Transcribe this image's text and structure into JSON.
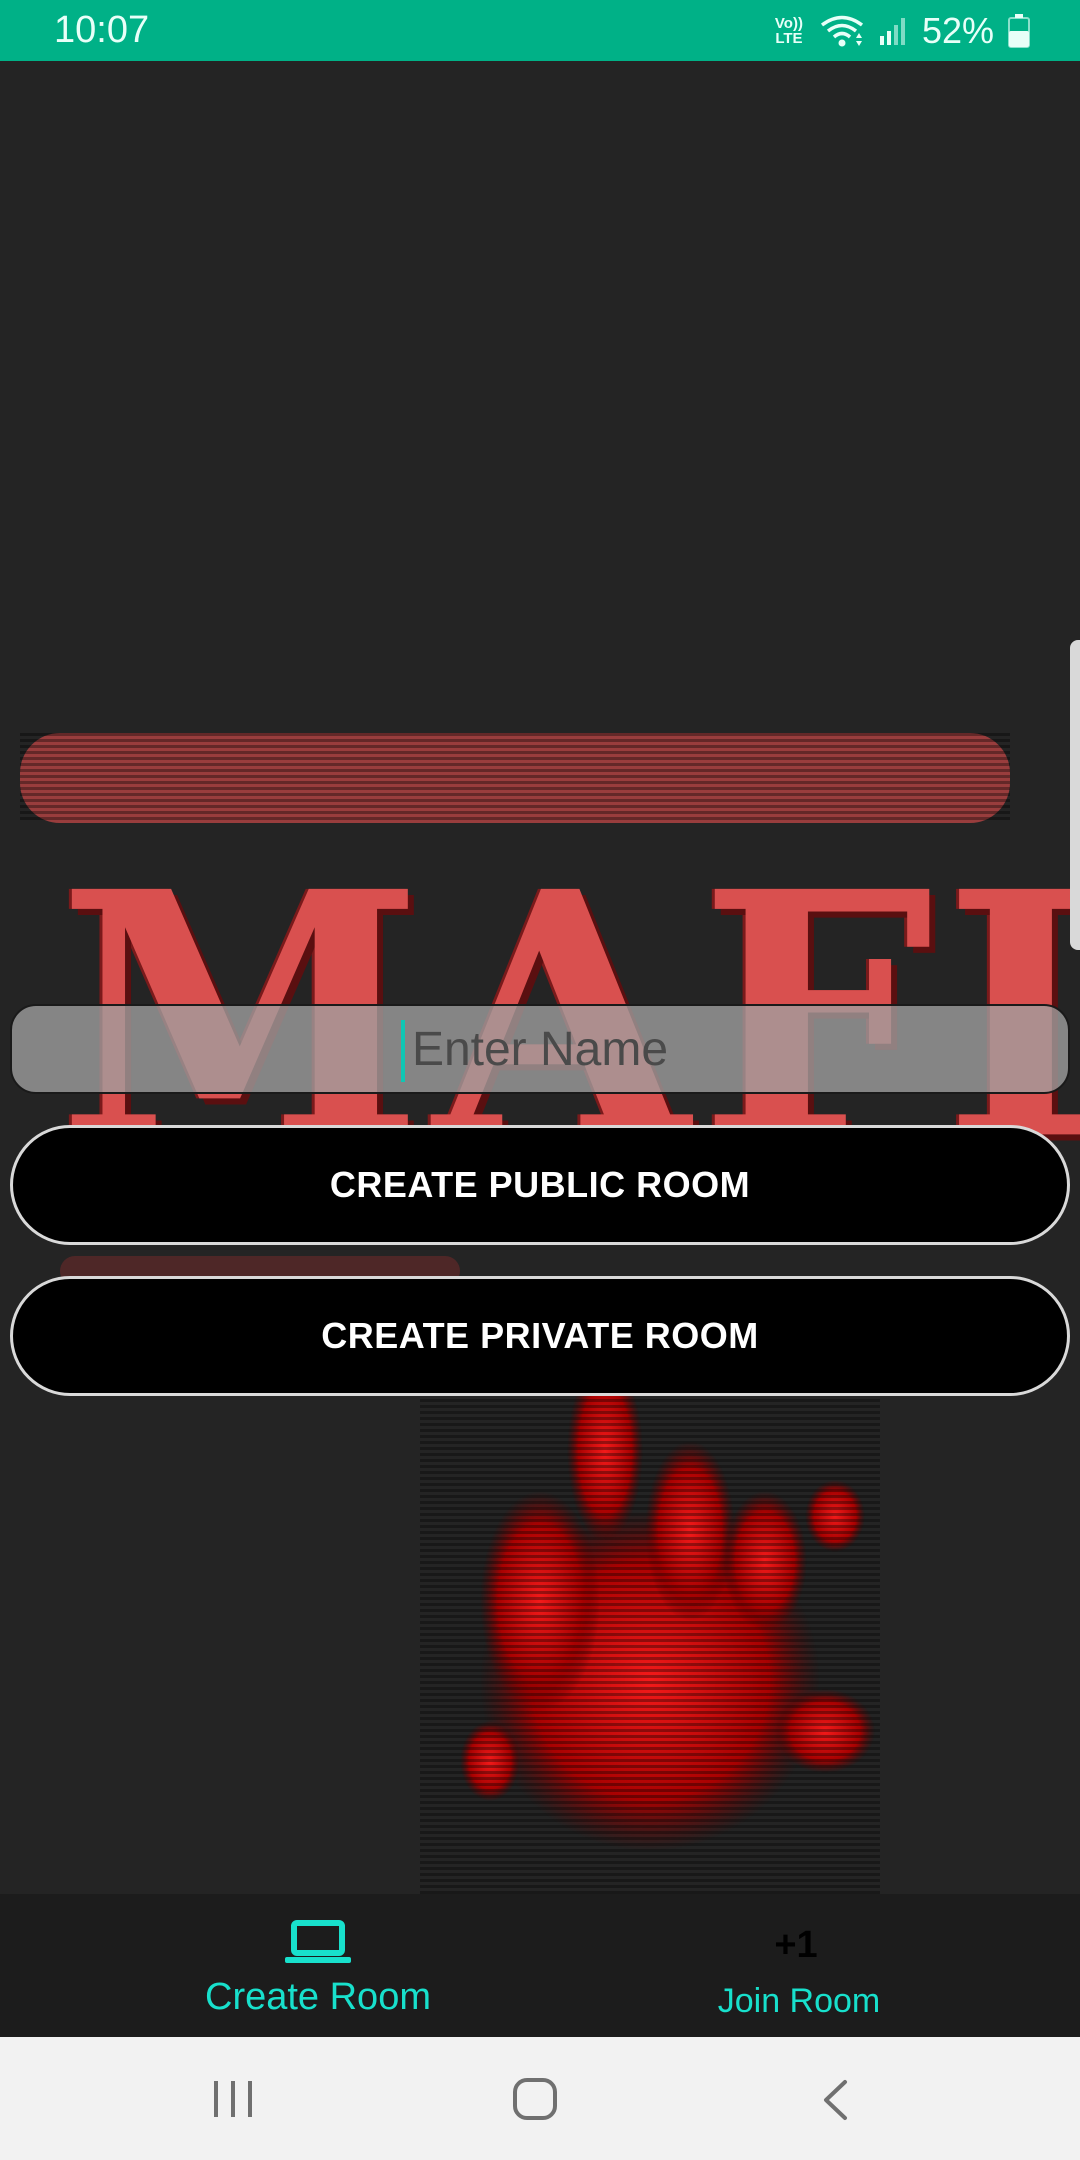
{
  "status_bar": {
    "time": "10:07",
    "network_label": "Vo)) LTE",
    "battery": "52%",
    "background_color": "#00b187",
    "icons": [
      "volte-icon",
      "wifi-icon",
      "signal-icon",
      "battery-icon"
    ]
  },
  "logo": {
    "text": "MAFIA",
    "color": "#d9504f",
    "background_art": "blood-hand-print"
  },
  "form": {
    "name_placeholder": "Enter Name",
    "name_value": "",
    "create_public_label": "CREATE PUBLIC ROOM",
    "create_private_label": "CREATE PRIVATE ROOM"
  },
  "bottom_nav": {
    "items": [
      {
        "label": "Create Room",
        "icon": "laptop-icon",
        "selected": true
      },
      {
        "label": "Join Room",
        "icon_text": "+1",
        "selected": false
      }
    ],
    "accent_color": "#18e0cc"
  },
  "system_nav": {
    "icons": [
      "recent-apps-icon",
      "home-icon",
      "back-icon"
    ]
  }
}
